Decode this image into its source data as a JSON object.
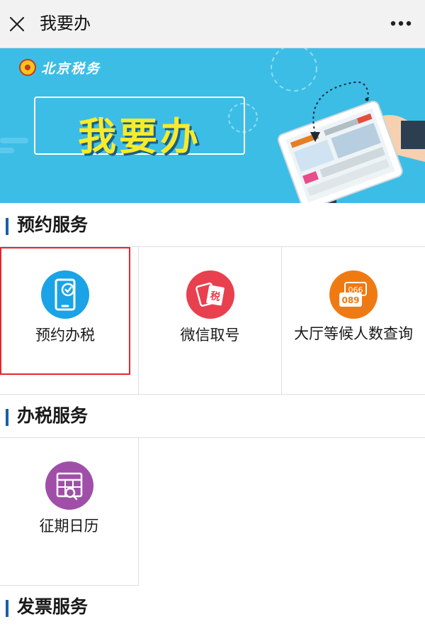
{
  "header": {
    "title": "我要办"
  },
  "banner": {
    "brand": "北京税务",
    "title": "我要办"
  },
  "sections": [
    {
      "title": "预约服务"
    },
    {
      "title": "办税服务"
    },
    {
      "title": "发票服务"
    }
  ],
  "reservation_items": [
    {
      "label": "预约办税"
    },
    {
      "label": "微信取号"
    },
    {
      "label": "大厅等候人数查询"
    }
  ],
  "tax_items": [
    {
      "label": "征期日历"
    }
  ],
  "icon_badge": {
    "line1": "066",
    "line2": "089"
  },
  "colors": {
    "accent_bar": "#1a5fa8",
    "banner_bg": "#3cbde6",
    "selection_border": "#e8262b",
    "icon_blue": "#1aa3e6",
    "icon_red": "#e8404e",
    "icon_orange": "#f07a12",
    "icon_purple": "#a04fa9"
  }
}
